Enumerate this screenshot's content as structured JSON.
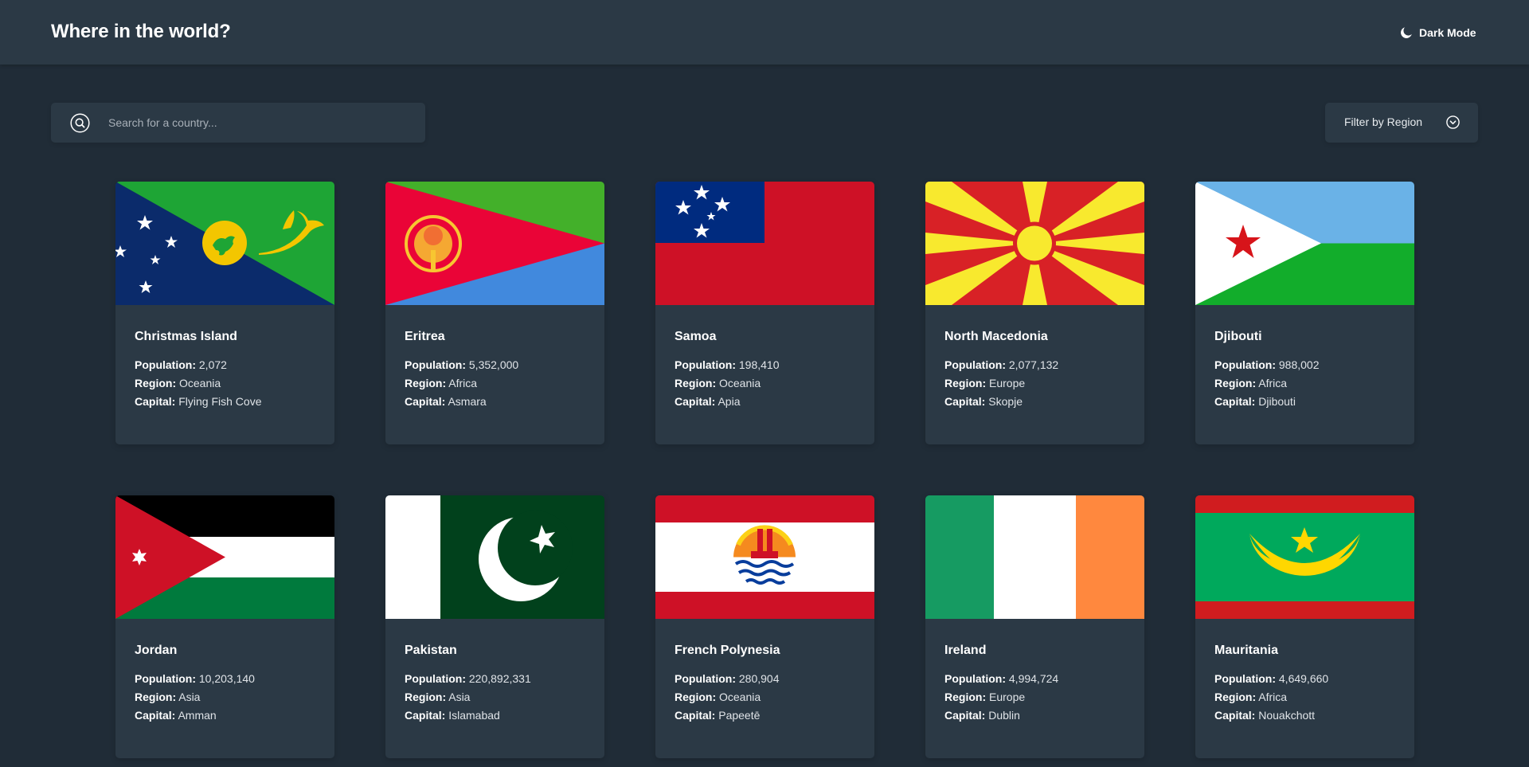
{
  "header": {
    "title": "Where in the world?",
    "mode_label": "Dark Mode",
    "mode_icon": "moon-icon"
  },
  "search": {
    "placeholder": "Search for a country...",
    "icon": "search-icon"
  },
  "filter": {
    "label": "Filter by Region",
    "icon": "chevron-down-icon"
  },
  "labels": {
    "population": "Population:",
    "region": "Region:",
    "capital": "Capital:"
  },
  "countries": [
    {
      "name": "Christmas Island",
      "population": "2,072",
      "region": "Oceania",
      "capital": "Flying Fish Cove"
    },
    {
      "name": "Eritrea",
      "population": "5,352,000",
      "region": "Africa",
      "capital": "Asmara"
    },
    {
      "name": "Samoa",
      "population": "198,410",
      "region": "Oceania",
      "capital": "Apia"
    },
    {
      "name": "North Macedonia",
      "population": "2,077,132",
      "region": "Europe",
      "capital": "Skopje"
    },
    {
      "name": "Djibouti",
      "population": "988,002",
      "region": "Africa",
      "capital": "Djibouti"
    },
    {
      "name": "Jordan",
      "population": "10,203,140",
      "region": "Asia",
      "capital": "Amman"
    },
    {
      "name": "Pakistan",
      "population": "220,892,331",
      "region": "Asia",
      "capital": "Islamabad"
    },
    {
      "name": "French Polynesia",
      "population": "280,904",
      "region": "Oceania",
      "capital": "Papeetē"
    },
    {
      "name": "Ireland",
      "population": "4,994,724",
      "region": "Europe",
      "capital": "Dublin"
    },
    {
      "name": "Mauritania",
      "population": "4,649,660",
      "region": "Africa",
      "capital": "Nouakchott"
    }
  ],
  "colors": {
    "background": "#202c37",
    "element": "#2b3945",
    "text": "#ffffff"
  }
}
